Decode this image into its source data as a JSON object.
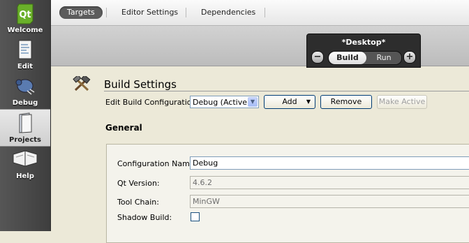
{
  "sidebar": {
    "modes": [
      {
        "label": "Welcome",
        "icon": "qt-logo-icon",
        "active": false
      },
      {
        "label": "Edit",
        "icon": "document-icon",
        "active": false
      },
      {
        "label": "Debug",
        "icon": "bug-icon",
        "active": false
      },
      {
        "label": "Projects",
        "icon": "folder-icon",
        "active": true
      },
      {
        "label": "Help",
        "icon": "book-icon",
        "active": false
      }
    ],
    "qt_logo_text": "Qt"
  },
  "tabs": [
    {
      "label": "Targets",
      "selected": true
    },
    {
      "label": "Editor Settings",
      "selected": false
    },
    {
      "label": "Dependencies",
      "selected": false
    }
  ],
  "target": {
    "name": "*Desktop*",
    "build_label": "Build",
    "run_label": "Run",
    "remove_symbol": "−",
    "add_symbol": "+"
  },
  "build_settings": {
    "title": "Build Settings",
    "edit_config_label": "Edit Build Configuration:",
    "config_value": "Debug (Active)",
    "add_label": "Add",
    "remove_label": "Remove",
    "make_active_label": "Make Active",
    "general_title": "General",
    "fields": {
      "config_name_label": "Configuration Name:",
      "config_name_value": "Debug",
      "qt_version_label": "Qt Version:",
      "qt_version_value": "4.6.2",
      "tool_chain_label": "Tool Chain:",
      "tool_chain_value": "MinGW",
      "shadow_build_label": "Shadow Build:",
      "shadow_build_checked": false
    }
  },
  "colors": {
    "sidebar_bg": "#4a4a4a",
    "target_box": "#2d2d2d",
    "qt_green": "#6ab02a",
    "window_bg": "#ece9d8"
  }
}
